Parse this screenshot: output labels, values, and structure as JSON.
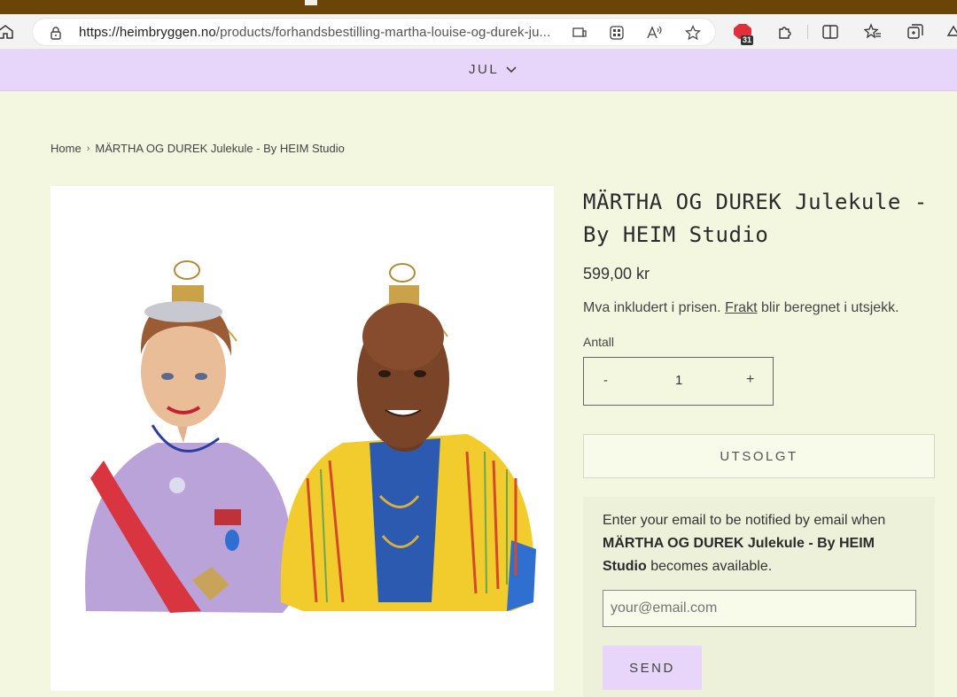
{
  "browser": {
    "url_host": "https://heimbryggen.no",
    "url_path": "/products/forhandsbestilling-martha-louise-og-durek-ju...",
    "badge_count": "31"
  },
  "nav": {
    "menu_label": "JUL"
  },
  "breadcrumb": {
    "home": "Home",
    "separator": "›",
    "current": "MÄRTHA OG DUREK Julekule - By HEIM Studio"
  },
  "product": {
    "title": "MÄRTHA OG DUREK Julekule - By HEIM Studio",
    "price": "599,00 kr",
    "tax_before": "Mva inkludert i prisen.",
    "tax_link": "Frakt",
    "tax_after": "blir beregnet i utsjekk.",
    "quantity_label": "Antall",
    "quantity_minus": "-",
    "quantity_value": "1",
    "quantity_plus": "+",
    "soldout_label": "UTSOLGT"
  },
  "notify": {
    "text_before": "Enter your email to be notified by email when",
    "product_name": "MÄRTHA OG DUREK Julekule - By HEIM Studio",
    "text_after": "becomes available.",
    "email_placeholder": "your@email.com",
    "send_label": "SEND"
  },
  "colors": {
    "page_bg": "#f4f7e0",
    "nav_bg": "#e7d5fa",
    "top_strip": "#6b4507",
    "notify_bg": "#eef1da"
  }
}
